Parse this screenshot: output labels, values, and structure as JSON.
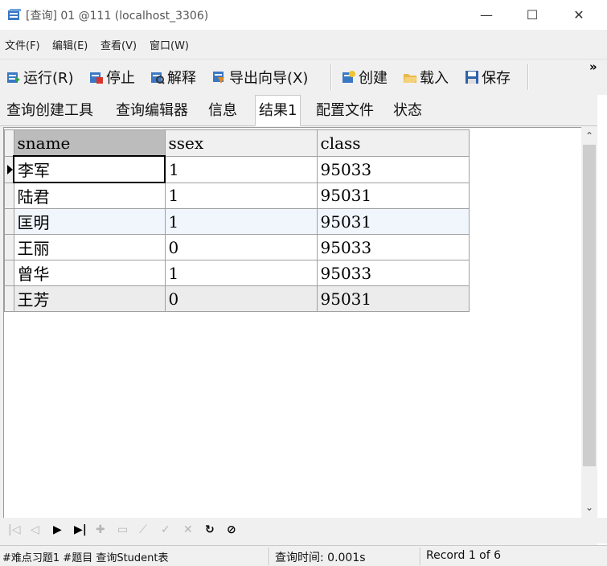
{
  "window": {
    "title": "[查询] 01 @111 (localhost_3306)",
    "minimize": "—",
    "maximize": "☐",
    "close": "✕"
  },
  "menu": [
    "文件(F)",
    "编辑(E)",
    "查看(V)",
    "窗口(W)"
  ],
  "toolbar": {
    "run": "运行(R)",
    "stop": "停止",
    "explain": "解释",
    "export": "导出向导(X)",
    "create": "创建",
    "load": "载入",
    "save": "保存",
    "overflow": "»"
  },
  "tabs": [
    "查询创建工具",
    "查询编辑器",
    "信息",
    "结果1",
    "配置文件",
    "状态"
  ],
  "active_tab": "结果1",
  "grid": {
    "columns": [
      "sname",
      "ssex",
      "class"
    ],
    "rows": [
      [
        "李军",
        "1",
        "95033"
      ],
      [
        "陆君",
        "1",
        "95031"
      ],
      [
        "匡明",
        "1",
        "95031"
      ],
      [
        "王丽",
        "0",
        "95033"
      ],
      [
        "曾华",
        "1",
        "95033"
      ],
      [
        "王芳",
        "0",
        "95031"
      ]
    ]
  },
  "status": {
    "query": "#难点习题1 #题目 查询Student表",
    "time": "查询时间: 0.001s",
    "record": "Record 1 of 6"
  },
  "icons": {
    "run": "run-icon",
    "stop": "stop-icon",
    "explain": "explain-icon",
    "export": "export-icon",
    "create": "create-icon",
    "load": "load-icon",
    "save": "save-icon"
  }
}
